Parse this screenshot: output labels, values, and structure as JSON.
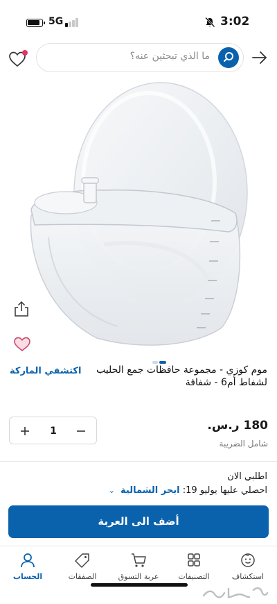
{
  "status_bar": {
    "network": "5G",
    "time": "3:02"
  },
  "search": {
    "placeholder": "ما الذي تبحثين عنه؟"
  },
  "product": {
    "brand_link": "اكتشفي الماركة",
    "title": "موم كوزي - مجموعة حافظات جمع الحليب لشفاط أم6 - شفافة",
    "price": "180 ر.س.",
    "tax_note": "شامل الضريبة",
    "quantity": "1",
    "image_pager": {
      "count": 2,
      "active": 1
    }
  },
  "delivery": {
    "order_now": "اطلبي الان",
    "prefix": "احصلي عليها يوليو 19:",
    "city": "ابحر الشمالية"
  },
  "cta": {
    "add_to_cart": "أضف الى العربة"
  },
  "bottom_nav": {
    "items": [
      {
        "label": "استكشاف",
        "icon": "explore-face-icon"
      },
      {
        "label": "التصنيفات",
        "icon": "categories-grid-icon"
      },
      {
        "label": "عربة التسوق",
        "icon": "cart-icon"
      },
      {
        "label": "الصفقات",
        "icon": "tag-icon"
      },
      {
        "label": "الحساب",
        "icon": "account-icon",
        "active": true
      }
    ]
  },
  "colors": {
    "accent": "#0a62ad",
    "favorite": "#e3365e"
  }
}
